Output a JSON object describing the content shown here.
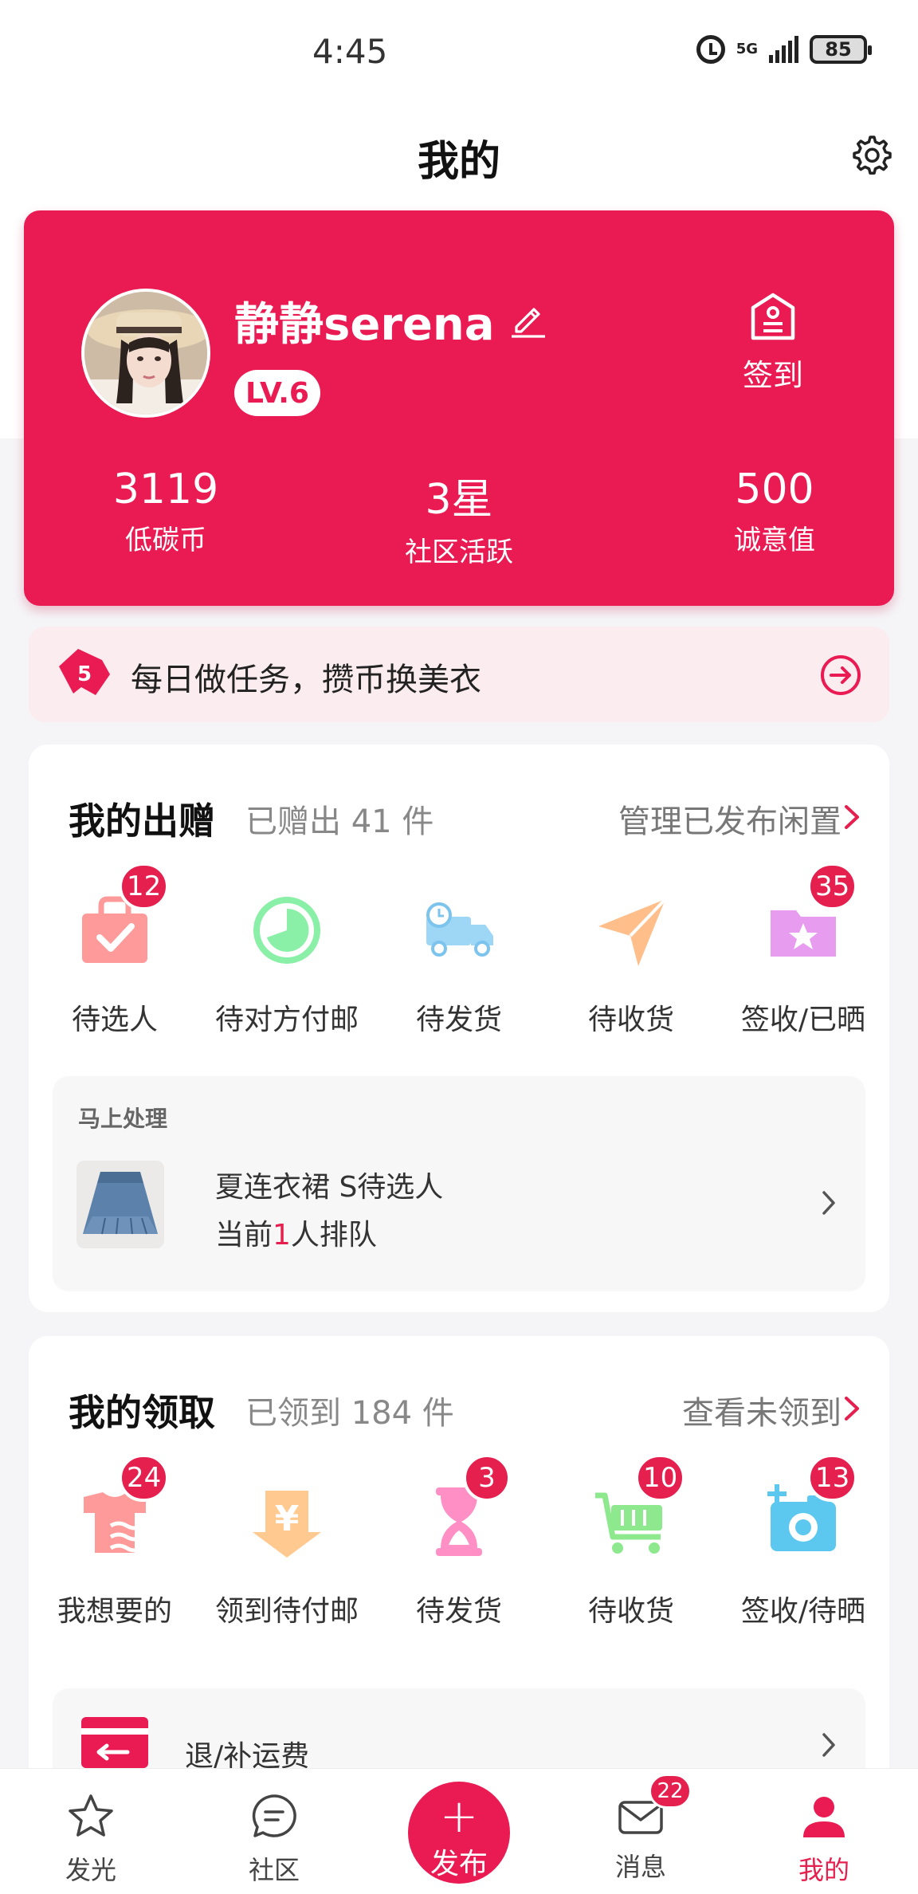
{
  "status_bar": {
    "time": "4:45",
    "network": "5G",
    "battery": "85"
  },
  "header": {
    "title": "我的"
  },
  "profile": {
    "username": "静静serena",
    "level": "LV.6",
    "checkin_label": "签到",
    "stats": [
      {
        "value": "3119",
        "label": "低碳币"
      },
      {
        "value": "3星",
        "label": "社区活跃"
      },
      {
        "value": "500",
        "label": "诚意值"
      }
    ]
  },
  "task_banner": {
    "text": "每日做任务，攒币换美衣"
  },
  "giving": {
    "title": "我的出赠",
    "count": "已赠出 41 件",
    "link": "管理已发布闲置",
    "items": [
      {
        "label": "待选人",
        "badge": "12",
        "icon": "bag-check-icon"
      },
      {
        "label": "待对方付邮",
        "badge": "",
        "icon": "clock-circle-icon"
      },
      {
        "label": "待发货",
        "badge": "",
        "icon": "truck-icon"
      },
      {
        "label": "待收货",
        "badge": "",
        "icon": "paper-plane-icon"
      },
      {
        "label": "签收/已晒",
        "badge": "35",
        "icon": "folder-star-icon"
      }
    ],
    "process": {
      "title": "马上处理",
      "item_name": "夏连衣裙 S待选人",
      "queue_prefix": "当前",
      "queue_count": "1",
      "queue_suffix": "人排队"
    }
  },
  "receiving": {
    "title": "我的领取",
    "count": "已领到 184 件",
    "link": "查看未领到",
    "items": [
      {
        "label": "我想要的",
        "badge": "24",
        "icon": "shirt-icon"
      },
      {
        "label": "领到待付邮",
        "badge": "",
        "icon": "yen-icon"
      },
      {
        "label": "待发货",
        "badge": "3",
        "icon": "hourglass-icon"
      },
      {
        "label": "待收货",
        "badge": "10",
        "icon": "cart-icon"
      },
      {
        "label": "签收/待晒",
        "badge": "13",
        "icon": "camera-icon"
      }
    ],
    "refund": {
      "label": "退/补运费"
    }
  },
  "bottom_nav": {
    "items": [
      {
        "label": "发光"
      },
      {
        "label": "社区"
      },
      {
        "label": "发布"
      },
      {
        "label": "消息",
        "badge": "22"
      },
      {
        "label": "我的"
      }
    ]
  },
  "colors": {
    "brand": "#ea1a52",
    "badge": "#e5204f"
  }
}
